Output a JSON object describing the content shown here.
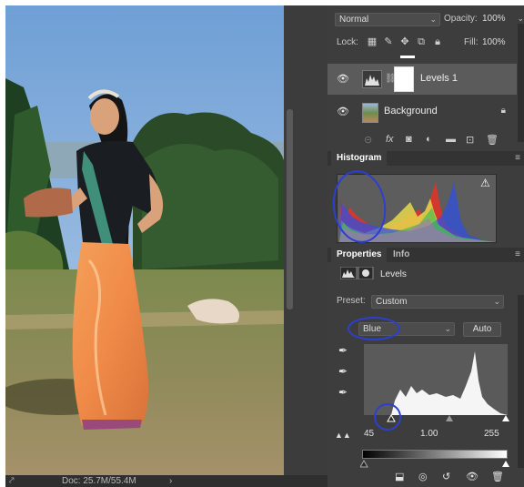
{
  "canvas": {
    "status_arrow": "⤤",
    "doc_info": "Doc: 25.7M/55.4M",
    "status_more": "›"
  },
  "layers": {
    "blend_mode": "Normal",
    "opacity_label": "Opacity:",
    "opacity_value": "100%",
    "lock_label": "Lock:",
    "fill_label": "Fill:",
    "fill_value": "100%",
    "items": [
      {
        "name": "Levels 1",
        "visible": true,
        "selected": true
      },
      {
        "name": "Background",
        "visible": true,
        "locked": true
      }
    ]
  },
  "histogram": {
    "tab_label": "Histogram",
    "warning_icon": "warning-triangle-icon"
  },
  "properties": {
    "tabs": [
      {
        "label": "Properties",
        "active": true
      },
      {
        "label": "Info",
        "active": false
      }
    ],
    "adjustment_title": "Levels",
    "preset_label": "Preset:",
    "preset_value": "Custom",
    "channel_value": "Blue",
    "auto_label": "Auto",
    "input_black": "45",
    "input_gamma": "1.00",
    "input_white": "255"
  },
  "annotations": {
    "color": "#2d3fd0"
  },
  "colors": {
    "panel_bg": "#3d3d3d",
    "accent_red": "#e0342a",
    "accent_yellow": "#e8d84a",
    "accent_blue": "#3050e0"
  }
}
